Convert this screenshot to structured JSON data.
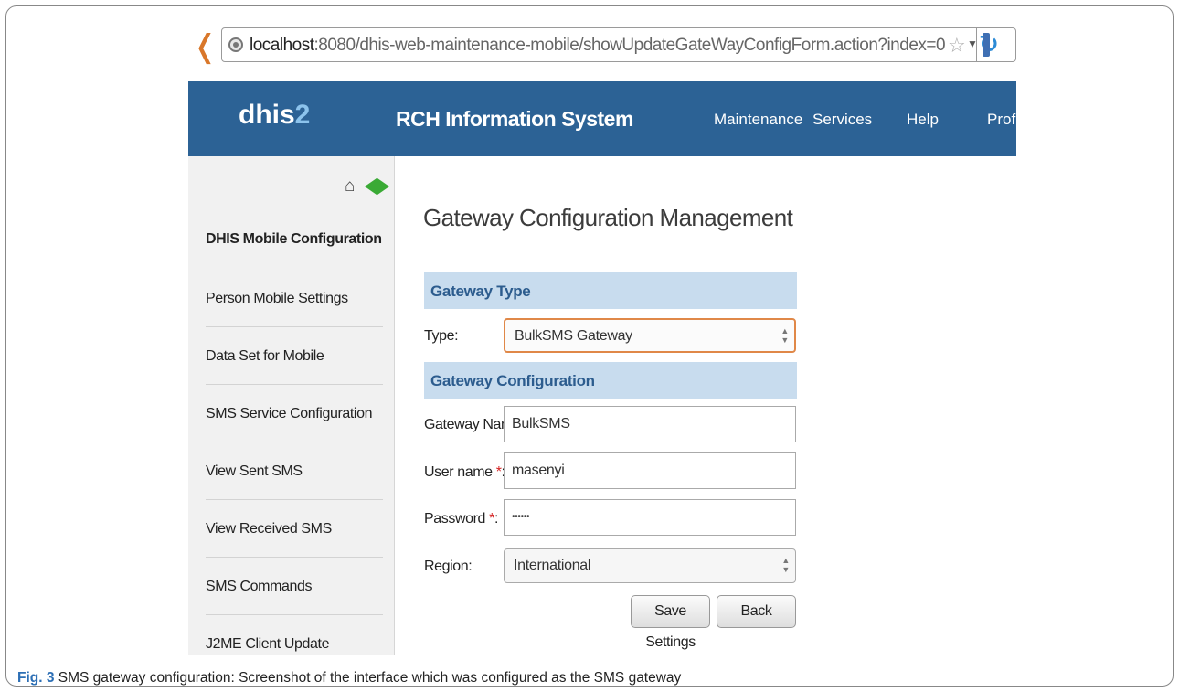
{
  "browser": {
    "url_host": "localhost",
    "url_rest": ":8080/dhis-web-maintenance-mobile/showUpdateGateWayConfigForm.action?index=0"
  },
  "header": {
    "logo_main": "dhis",
    "logo_suffix": "2",
    "system_title": "RCH Information System",
    "nav": [
      "Maintenance",
      "Services",
      "Help",
      "Profil"
    ]
  },
  "sidebar": {
    "title": "DHIS Mobile Configuration",
    "items": [
      "Person Mobile Settings",
      "Data Set for Mobile",
      "SMS Service Configuration",
      "View Sent SMS",
      "View Received SMS",
      "SMS Commands",
      "J2ME Client Update"
    ]
  },
  "main": {
    "page_title": "Gateway Configuration Management",
    "gateway_type_section": "Gateway Type",
    "type_label": "Type:",
    "type_value": "BulkSMS Gateway",
    "gateway_config_section": "Gateway Configuration",
    "gateway_name_label": "Gateway Name:",
    "gateway_name_value": "BulkSMS",
    "username_label": "User name ",
    "username_value": "masenyi",
    "password_label": "Password ",
    "password_value": "••••••",
    "required_marker": "*",
    "required_suffix": ":",
    "region_label": "Region:",
    "region_value": "International",
    "save_label": "Save Settings",
    "back_label": "Back"
  },
  "caption": {
    "fig": "Fig. 3",
    "text": " SMS gateway configuration: Screenshot of the interface which was configured as the SMS gateway"
  }
}
